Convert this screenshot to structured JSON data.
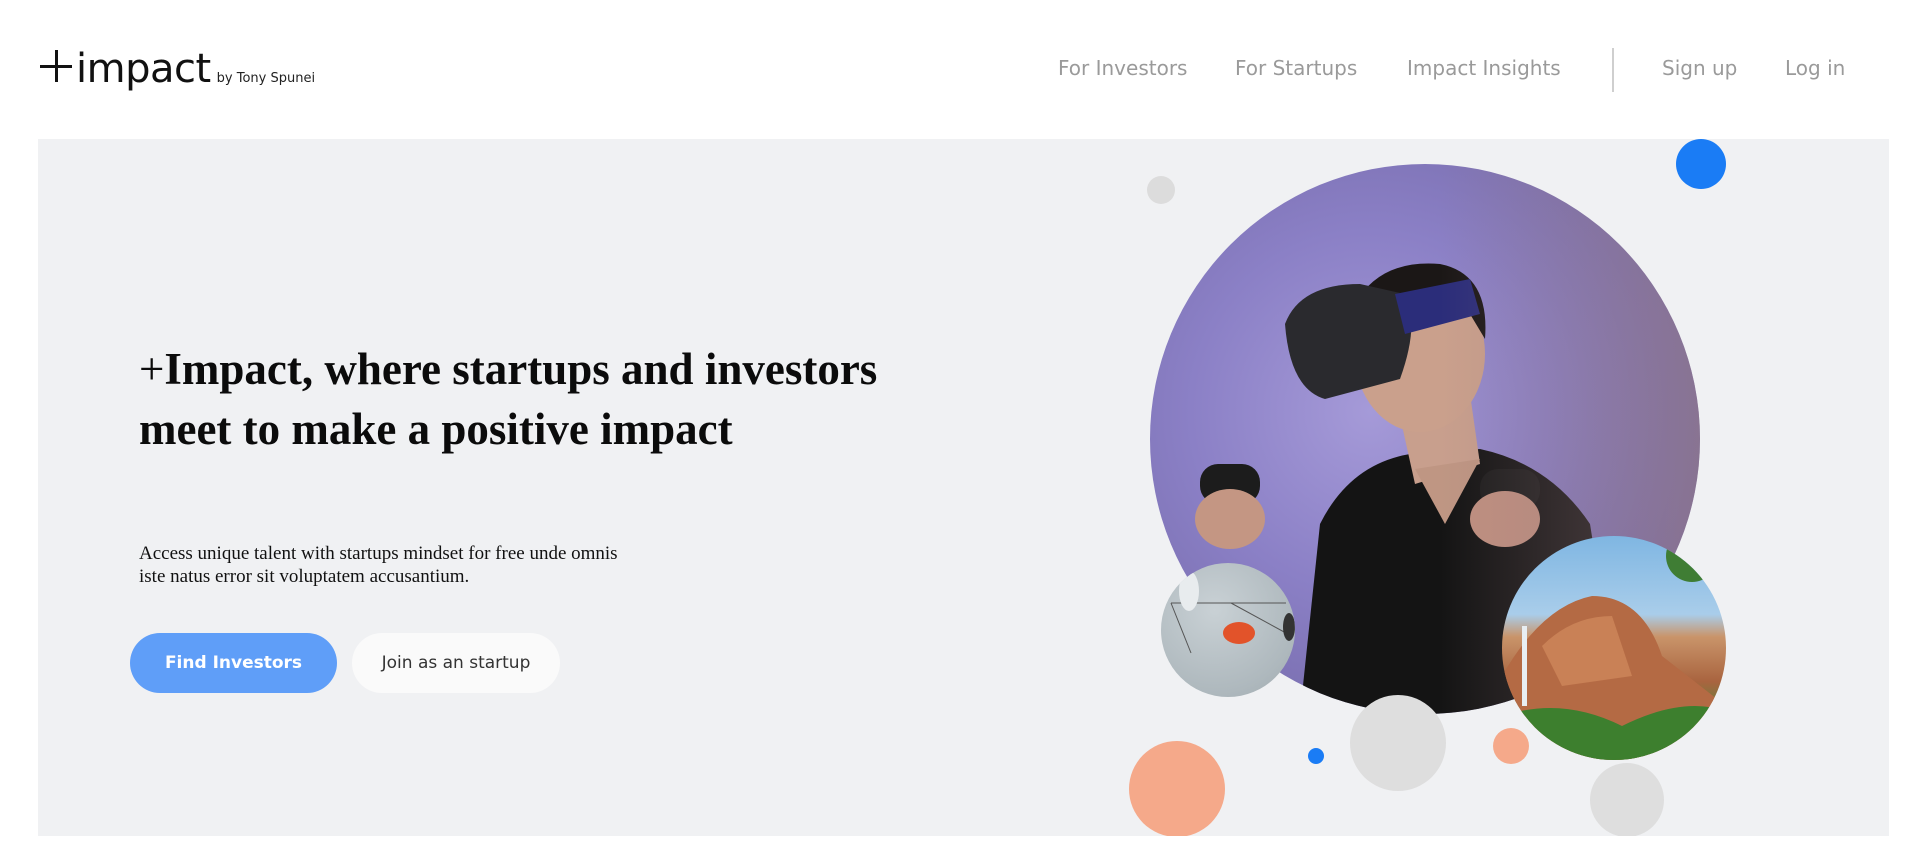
{
  "brand": {
    "name": "impact",
    "byline": "by Tony Spunei"
  },
  "nav": {
    "items": [
      "For Investors",
      "For Startups",
      "Impact Insights"
    ],
    "signup": "Sign up",
    "login": "Log in"
  },
  "hero": {
    "headline_plus": "+",
    "headline": "Impact, where startups and investors meet to make a positive impact",
    "subtext": "Access unique talent with startups mindset for free unde omnis iste natus error sit voluptatem accusantium.",
    "primary_button": "Find Investors",
    "secondary_button": "Join as an startup"
  },
  "colors": {
    "accent_blue": "#1a7cf5",
    "button_blue": "#5f9ef8",
    "peach": "#f5a98a",
    "hero_bg": "#f0f1f3",
    "nav_text": "#9a9a9a"
  }
}
